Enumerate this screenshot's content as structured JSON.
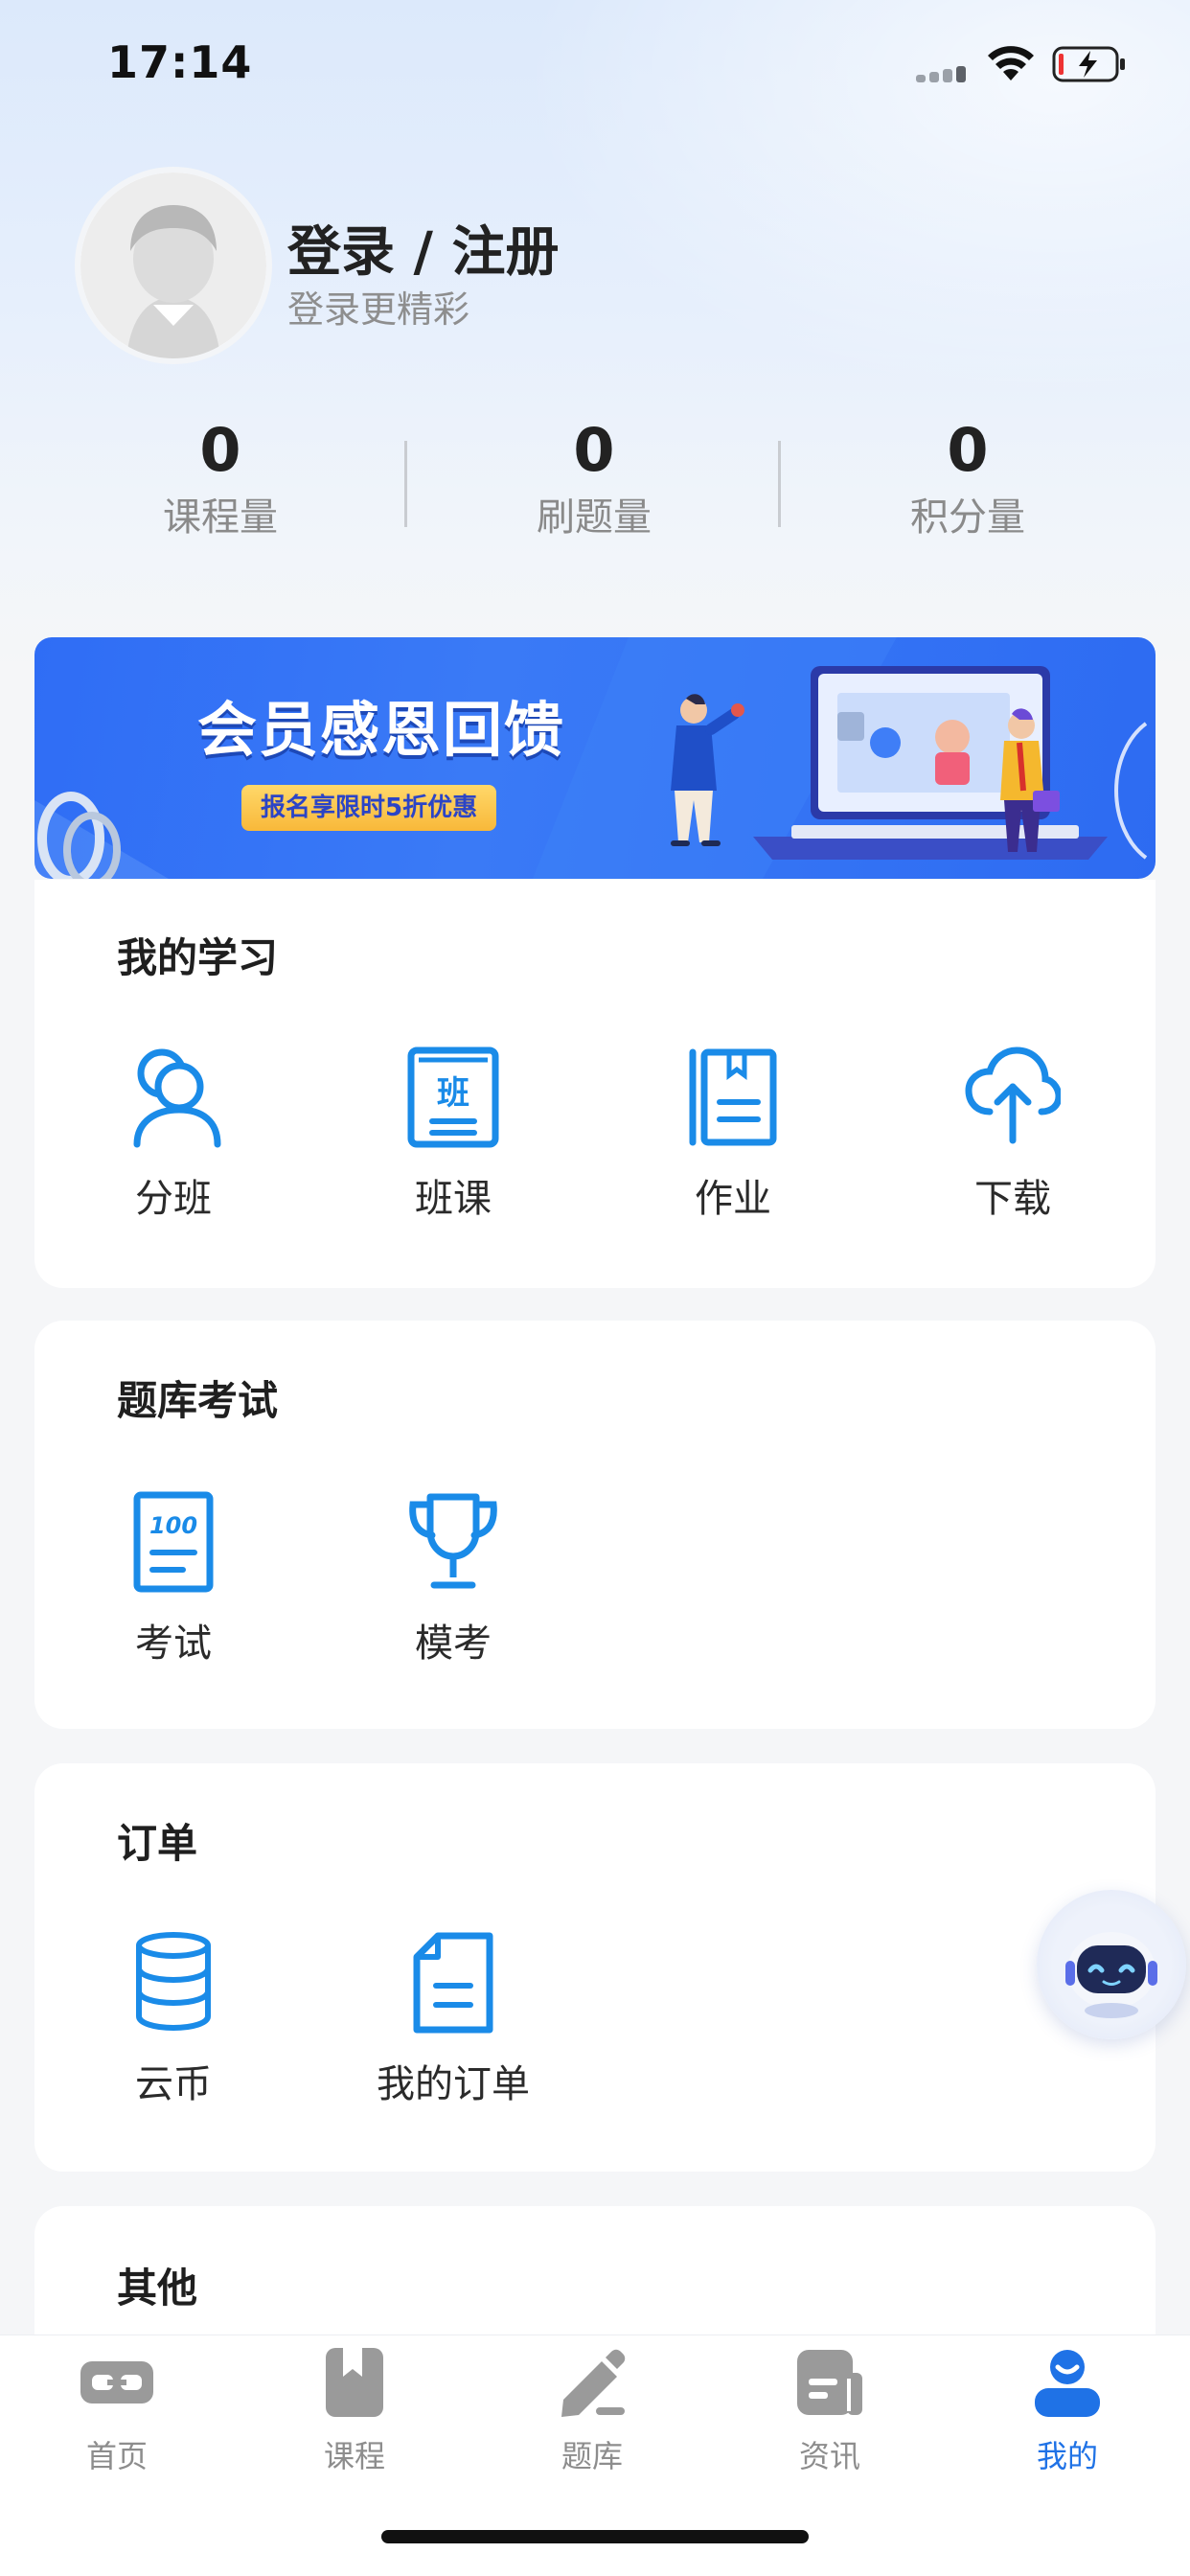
{
  "status_bar": {
    "time": "17:14",
    "icons": [
      "signal-icon",
      "wifi-icon",
      "battery-charging-icon"
    ]
  },
  "profile": {
    "title": "登录 / 注册",
    "subtitle": "登录更精彩"
  },
  "stats": [
    {
      "value": "0",
      "label": "课程量"
    },
    {
      "value": "0",
      "label": "刷题量"
    },
    {
      "value": "0",
      "label": "积分量"
    }
  ],
  "banner": {
    "title": "会员感恩回馈",
    "tag": "报名享限时5折优惠"
  },
  "sections": {
    "study": {
      "title": "我的学习",
      "items": [
        {
          "label": "分班",
          "icon": "users-icon"
        },
        {
          "label": "班课",
          "icon": "class-book-icon",
          "icon_text": "班"
        },
        {
          "label": "作业",
          "icon": "homework-icon"
        },
        {
          "label": "下载",
          "icon": "cloud-upload-icon"
        }
      ]
    },
    "exam": {
      "title": "题库考试",
      "items": [
        {
          "label": "考试",
          "icon": "exam-paper-icon",
          "icon_text": "100"
        },
        {
          "label": "模考",
          "icon": "trophy-icon"
        }
      ]
    },
    "orders": {
      "title": "订单",
      "items": [
        {
          "label": "云币",
          "icon": "coin-stack-icon"
        },
        {
          "label": "我的订单",
          "icon": "order-document-icon"
        }
      ]
    },
    "other": {
      "title": "其他"
    }
  },
  "tabbar": [
    {
      "label": "首页",
      "icon": "home-link-icon",
      "active": false
    },
    {
      "label": "课程",
      "icon": "bookmark-icon",
      "active": false
    },
    {
      "label": "题库",
      "icon": "pencil-icon",
      "active": false
    },
    {
      "label": "资讯",
      "icon": "news-icon",
      "active": false
    },
    {
      "label": "我的",
      "icon": "user-icon",
      "active": true
    }
  ],
  "colors": {
    "accent": "#1f72e6",
    "icon_blue": "#1a8be8",
    "banner_blue": "#2f6df5",
    "tab_inactive": "#9a9a9a"
  }
}
